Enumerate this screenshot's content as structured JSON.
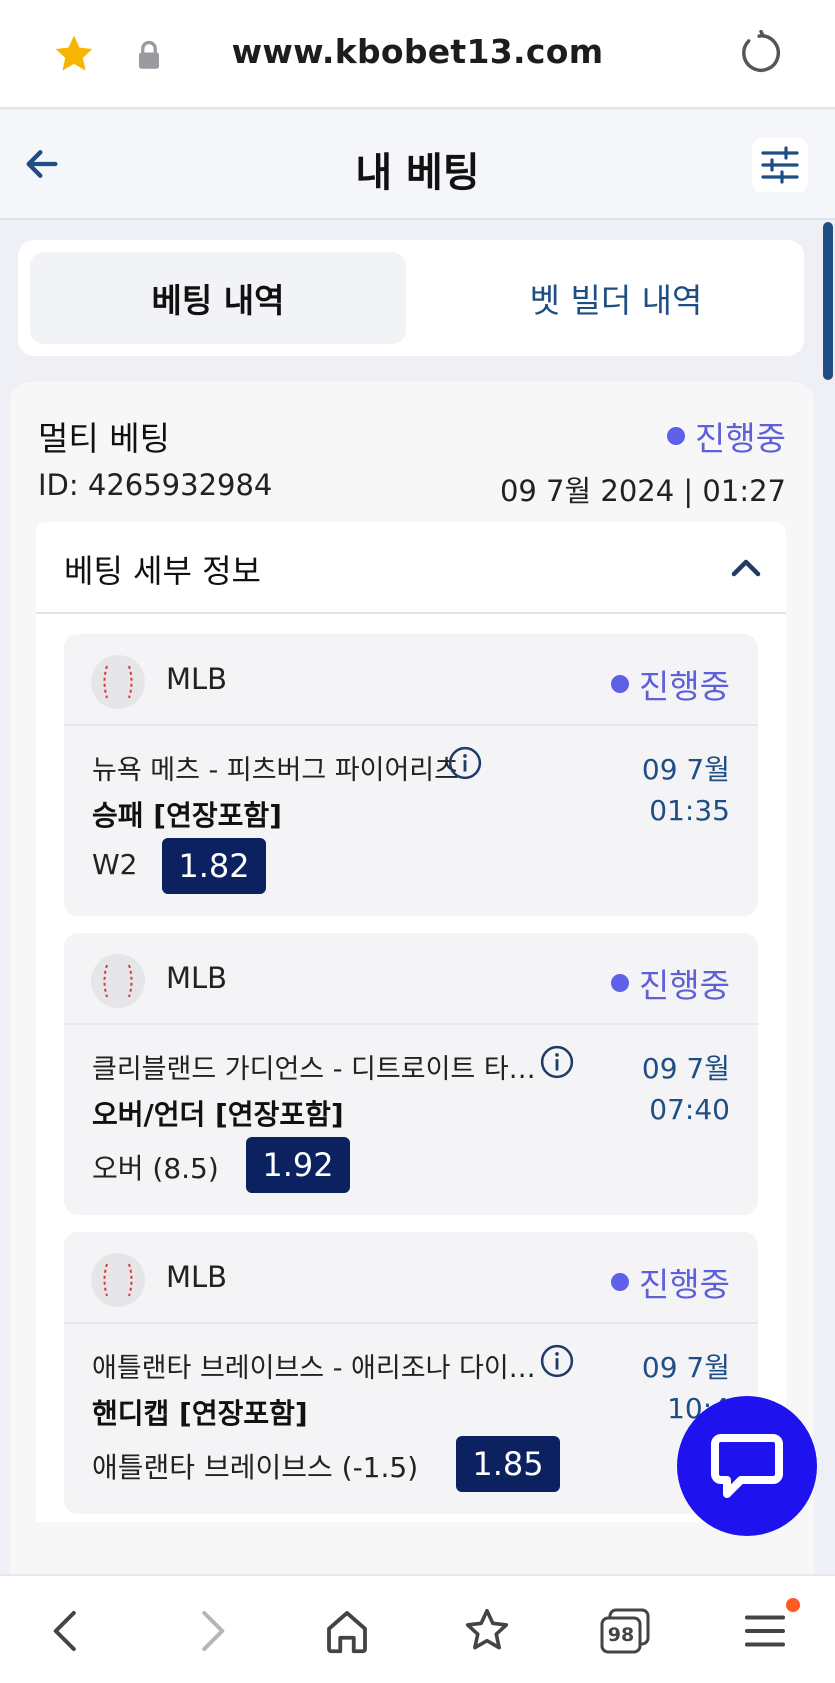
{
  "browser": {
    "url": "www.kbobet13.com",
    "accent_star": "#f7b500"
  },
  "header": {
    "title": "내 베팅"
  },
  "tabs": [
    {
      "label": "베팅 내역",
      "active": true
    },
    {
      "label": "벳 빌더 내역",
      "active": false
    }
  ],
  "bet": {
    "type": "멀티 베팅",
    "status": "진행중",
    "id": "ID: 4265932984",
    "date": "09 7월 2024 | 01:27",
    "details_title": "베팅 세부 정보",
    "selections": [
      {
        "league": "MLB",
        "status": "진행중",
        "match": "뉴욕 메츠 - 피츠버그 파이어리츠",
        "market": "승패 [연장포함]",
        "pick": "W2",
        "odds": "1.82",
        "date": "09 7월",
        "time": "01:35"
      },
      {
        "league": "MLB",
        "status": "진행중",
        "match": "클리블랜드 가디언스 - 디트로이트 타…",
        "market": "오버/언더 [연장포함]",
        "pick": "오버 (8.5)",
        "odds": "1.92",
        "date": "09 7월",
        "time": "07:40"
      },
      {
        "league": "MLB",
        "status": "진행중",
        "match": "애틀랜타 브레이브스 - 애리조나 다이…",
        "market": "핸디캡 [연장포함]",
        "pick": "애틀랜타 브레이브스 (-1.5)",
        "odds": "1.85",
        "date": "09 7월",
        "time": "10:4"
      }
    ]
  },
  "bottom_nav": {
    "tabs_count": "98"
  }
}
